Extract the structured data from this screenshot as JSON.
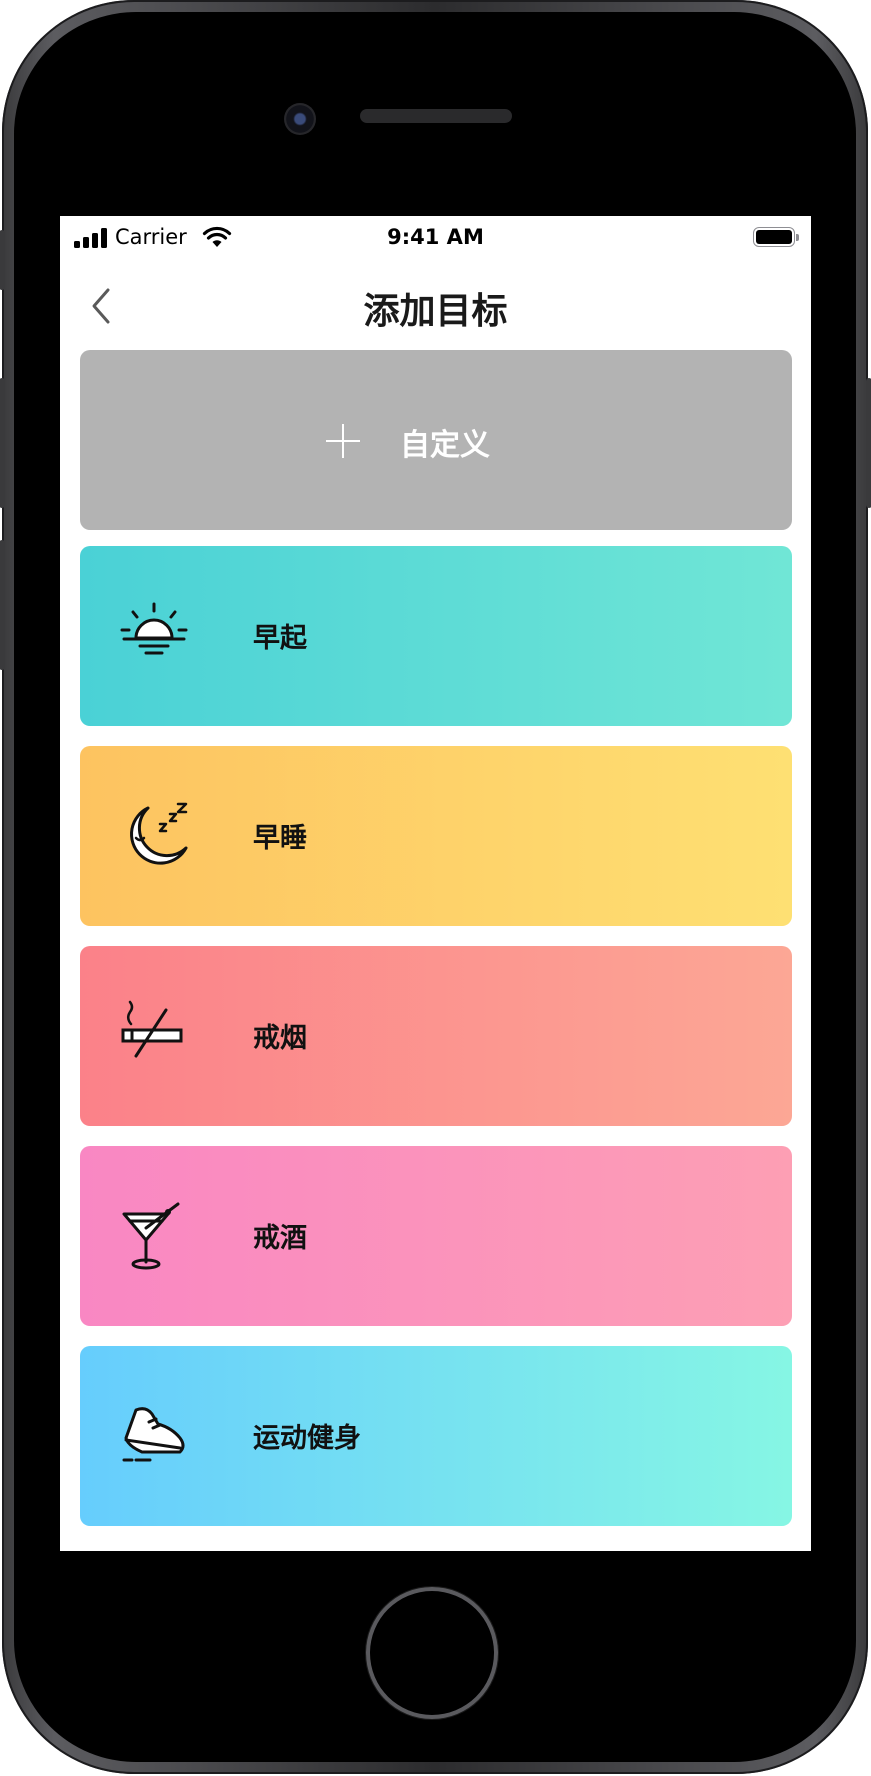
{
  "status_bar": {
    "carrier": "Carrier",
    "time": "9:41 AM"
  },
  "navbar": {
    "title": "添加目标",
    "back_icon": "chevron-left-icon"
  },
  "goals": [
    {
      "label": "自定义",
      "icon": "plus-icon",
      "color": "#b3b3b3"
    },
    {
      "label": "早起",
      "icon": "sunrise-icon",
      "gradient": [
        "#4ad1d6",
        "#70e6d6"
      ]
    },
    {
      "label": "早睡",
      "icon": "moon-sleep-icon",
      "gradient": [
        "#fdc360",
        "#fee073"
      ]
    },
    {
      "label": "戒烟",
      "icon": "no-smoking-icon",
      "gradient": [
        "#fb8189",
        "#fca795"
      ]
    },
    {
      "label": "戒酒",
      "icon": "cocktail-icon",
      "gradient": [
        "#f987c3",
        "#fd9fb4"
      ]
    },
    {
      "label": "运动健身",
      "icon": "sneaker-icon",
      "gradient": [
        "#66cdfd",
        "#86f6e4"
      ]
    }
  ]
}
